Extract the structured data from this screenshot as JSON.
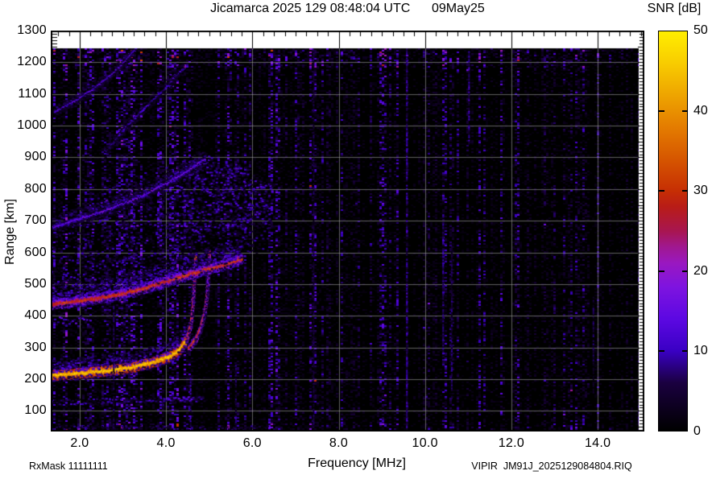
{
  "header": {
    "title": "Jicamarca 2025 129 08:48:04 UTC      09May25",
    "colorbar_title": "SNR [dB]"
  },
  "footer": {
    "rx_mask": "RxMask 11111111",
    "file_label": "VIPIR  JM91J_2025129084804.RIQ"
  },
  "chart_data": {
    "type": "heatmap",
    "title": "Jicamarca 2025 129 08:48:04 UTC      09May25",
    "xlabel": "Frequency [MHz]",
    "ylabel": "Range [km]",
    "xlim": [
      1.33,
      15.08
    ],
    "ylim": [
      35,
      1300
    ],
    "x_ticks": {
      "values": [
        2,
        4,
        6,
        8,
        10,
        12,
        14
      ],
      "labels": [
        "2.0",
        "4.0",
        "6.0",
        "8.0",
        "10.0",
        "12.0",
        "14.0"
      ]
    },
    "x_minor_step": 0.25,
    "y_ticks": [
      100,
      200,
      300,
      400,
      500,
      600,
      700,
      800,
      900,
      1000,
      1100,
      1200,
      1300
    ],
    "y_minor_step": 10,
    "grid": {
      "color": "rgba(158,158,158,0.6)",
      "x_every": 2,
      "y_every": 100
    },
    "background": "#000000",
    "data_extent": {
      "f": [
        1.33,
        14.95
      ],
      "r": [
        35,
        1245
      ]
    },
    "colorbar": {
      "label": "SNR [dB]",
      "min": 0,
      "max": 50,
      "ticks": [
        0,
        10,
        20,
        30,
        40,
        50
      ],
      "dash_ticks": [
        10,
        20,
        30,
        40
      ],
      "stops": [
        [
          0,
          "#000000"
        ],
        [
          6,
          "#1a0040"
        ],
        [
          10,
          "#3a00c4"
        ],
        [
          14,
          "#5c08e2"
        ],
        [
          18,
          "#7e14e0"
        ],
        [
          21,
          "#9a18c0"
        ],
        [
          23,
          "#a01890"
        ],
        [
          25,
          "#a81650"
        ],
        [
          28,
          "#b81c18"
        ],
        [
          30,
          "#c62e04"
        ],
        [
          34,
          "#d65600"
        ],
        [
          38,
          "#e47c00"
        ],
        [
          42,
          "#eea400"
        ],
        [
          46,
          "#f8cc00"
        ],
        [
          50,
          "#ffee00"
        ]
      ]
    },
    "noise": {
      "seed": 1337,
      "base_snr": 13,
      "column_boosts": [
        {
          "f": 3.05,
          "amp": 0.5
        },
        {
          "f": 6.55,
          "amp": 0.35
        },
        {
          "f": 8.3,
          "amp": 0.3
        },
        {
          "f": 9.0,
          "amp": 0.3
        },
        {
          "f": 12.1,
          "amp": 0.3
        },
        {
          "f": 12.8,
          "amp": 0.3
        }
      ],
      "top_band_min_r": 1185,
      "bottom_band_max_r": 62
    },
    "features": [
      {
        "name": "E-trace",
        "type": "trace",
        "points": [
          [
            1.33,
            213
          ],
          [
            2.0,
            220
          ],
          [
            2.6,
            228
          ],
          [
            3.2,
            240
          ],
          [
            3.7,
            255
          ],
          [
            4.05,
            272
          ],
          [
            4.3,
            295
          ],
          [
            4.45,
            325
          ]
        ],
        "snr": 46,
        "core_w": 3,
        "fuzz_up_km": 42,
        "fuzz_snr": 15,
        "fuzz_density": 4,
        "fuzz_down_km": 12
      },
      {
        "name": "E-cusp-O",
        "type": "trace",
        "points": [
          [
            4.45,
            325
          ],
          [
            4.55,
            372
          ],
          [
            4.6,
            432
          ],
          [
            4.63,
            500
          ],
          [
            4.65,
            558
          ],
          [
            4.66,
            592
          ]
        ],
        "snr": 36,
        "core_w": 2,
        "fuzz_up_km": 8,
        "fuzz_snr": 12,
        "fuzz_density": 1,
        "fuzz_down_km": 4
      },
      {
        "name": "E-cusp-X",
        "type": "trace",
        "points": [
          [
            4.5,
            298
          ],
          [
            4.66,
            325
          ],
          [
            4.78,
            362
          ],
          [
            4.87,
            410
          ],
          [
            4.93,
            468
          ],
          [
            4.96,
            532
          ],
          [
            4.98,
            602
          ]
        ],
        "snr": 33,
        "core_w": 2,
        "fuzz_up_km": 8,
        "fuzz_snr": 11,
        "fuzz_density": 1,
        "fuzz_down_km": 4
      },
      {
        "name": "F-trace",
        "type": "trace",
        "points": [
          [
            1.33,
            437
          ],
          [
            1.9,
            447
          ],
          [
            2.5,
            459
          ],
          [
            3.0,
            472
          ],
          [
            3.5,
            490
          ],
          [
            4.0,
            511
          ],
          [
            4.5,
            531
          ],
          [
            5.0,
            551
          ],
          [
            5.4,
            566
          ],
          [
            5.75,
            582
          ]
        ],
        "snr": 31,
        "core_w": 3,
        "fuzz_up_km": 60,
        "fuzz_snr": 14,
        "fuzz_density": 4,
        "fuzz_down_km": 10
      },
      {
        "name": "spread-F-cloud",
        "type": "band",
        "cols": [
          [
            1.33,
            448,
            690
          ],
          [
            2.0,
            458,
            750
          ],
          [
            2.6,
            470,
            800
          ],
          [
            3.2,
            486,
            842
          ],
          [
            3.8,
            502,
            872
          ],
          [
            4.4,
            522,
            896
          ],
          [
            5.0,
            548,
            900
          ],
          [
            5.5,
            570,
            880
          ],
          [
            6.0,
            592,
            846
          ],
          [
            6.4,
            608,
            808
          ]
        ],
        "snr": 11,
        "density": 0.6
      },
      {
        "name": "spread-F-lobe",
        "type": "band",
        "cols": [
          [
            4.3,
            640,
            900
          ],
          [
            5.0,
            655,
            906
          ],
          [
            5.6,
            668,
            886
          ],
          [
            6.1,
            684,
            850
          ],
          [
            6.45,
            700,
            812
          ]
        ],
        "snr": 13,
        "density": 0.9
      },
      {
        "name": "multihop-arc-1",
        "type": "trace",
        "points": [
          [
            1.33,
            680
          ],
          [
            2.0,
            708
          ],
          [
            2.7,
            740
          ],
          [
            3.4,
            778
          ],
          [
            4.0,
            820
          ],
          [
            4.5,
            860
          ],
          [
            4.9,
            900
          ]
        ],
        "snr": 15,
        "core_w": 2,
        "fuzz_up_km": 30,
        "fuzz_snr": 10,
        "fuzz_density": 2,
        "fuzz_down_km": 14
      },
      {
        "name": "multihop-arc-2",
        "type": "trace",
        "points": [
          [
            1.4,
            1045
          ],
          [
            1.9,
            1082
          ],
          [
            2.4,
            1128
          ],
          [
            2.9,
            1186
          ],
          [
            3.3,
            1248
          ]
        ],
        "snr": 12,
        "core_w": 2,
        "fuzz_up_km": 16,
        "fuzz_snr": 8,
        "fuzz_density": 1,
        "fuzz_down_km": 8
      },
      {
        "name": "multihop-arc-3",
        "type": "trace",
        "points": [
          [
            2.6,
            920
          ],
          [
            3.0,
            990
          ],
          [
            3.5,
            1060
          ],
          [
            4.0,
            1126
          ],
          [
            4.4,
            1186
          ]
        ],
        "snr": 9,
        "core_w": 2,
        "fuzz_up_km": 22,
        "fuzz_snr": 7,
        "fuzz_density": 1,
        "fuzz_down_km": 10
      },
      {
        "name": "E-second-echo",
        "type": "band",
        "cols": [
          [
            1.33,
            122,
            138
          ],
          [
            3.0,
            126,
            142
          ],
          [
            4.9,
            132,
            148
          ]
        ],
        "snr": 12,
        "density": 0.5
      },
      {
        "name": "E-second-echo-bright",
        "type": "band",
        "cols": [
          [
            3.9,
            130,
            142
          ],
          [
            4.85,
            134,
            148
          ]
        ],
        "snr": 15,
        "density": 0.9
      },
      {
        "name": "left-blob",
        "type": "band",
        "cols": [
          [
            1.33,
            368,
            398
          ],
          [
            2.25,
            374,
            402
          ]
        ],
        "snr": 15,
        "density": 0.8
      },
      {
        "name": "bottom-band",
        "type": "band",
        "cols": [
          [
            1.33,
            36,
            58
          ],
          [
            6.6,
            36,
            54
          ]
        ],
        "snr": 8,
        "density": 0.45
      },
      {
        "name": "interference-4.6",
        "type": "vline",
        "f": 4.57,
        "r0": 35,
        "r1": 212,
        "snr": 12,
        "w": 2
      },
      {
        "name": "interference-2.8",
        "type": "vline",
        "f": 2.79,
        "r0": 35,
        "r1": 436,
        "snr": 8,
        "w": 2
      },
      {
        "name": "interference-5.6",
        "type": "vline",
        "f": 5.62,
        "r0": 35,
        "r1": 250,
        "snr": 8,
        "w": 2
      },
      {
        "name": "interference-7.4",
        "type": "vline",
        "f": 7.42,
        "r0": 35,
        "r1": 1245,
        "snr": 7,
        "w": 2
      },
      {
        "name": "interference-9.6",
        "type": "vline",
        "f": 9.58,
        "r0": 35,
        "r1": 1245,
        "snr": 12,
        "w": 2
      },
      {
        "name": "interference-10.4",
        "type": "vline",
        "f": 10.42,
        "r0": 280,
        "r1": 720,
        "snr": 10,
        "w": 2
      },
      {
        "name": "interference-10.6",
        "type": "vline",
        "f": 10.62,
        "r0": 140,
        "r1": 620,
        "snr": 9,
        "w": 2
      },
      {
        "name": "interference-11.0",
        "type": "vline",
        "f": 11.02,
        "r0": 940,
        "r1": 1245,
        "snr": 13,
        "w": 2
      },
      {
        "name": "interference-13.9",
        "type": "vline",
        "f": 13.9,
        "r0": 160,
        "r1": 460,
        "snr": 8,
        "w": 2
      }
    ]
  }
}
